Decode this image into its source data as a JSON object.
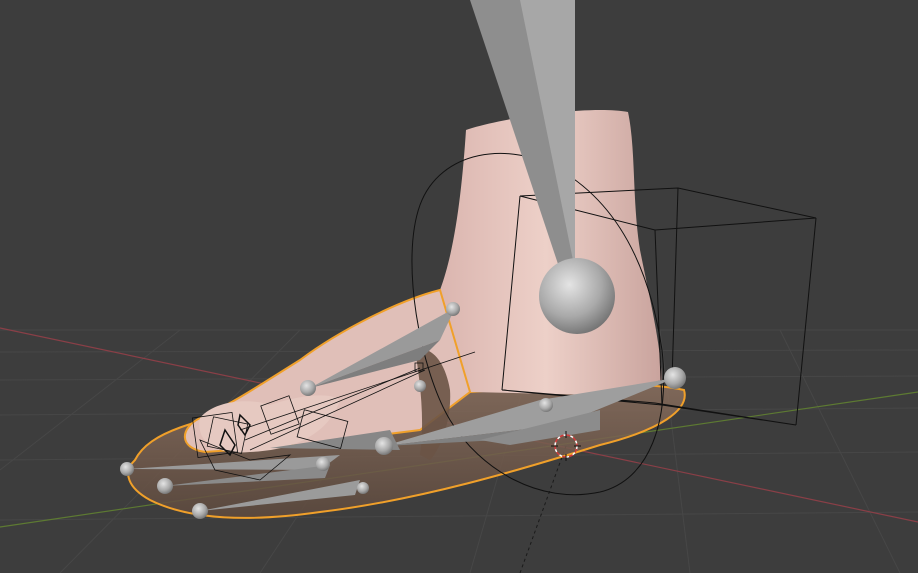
{
  "viewport": {
    "mode": "3D Viewport",
    "background_color": "#3d3d3d",
    "grid_color": "#474747",
    "x_axis_color": "#8a3f47",
    "y_axis_color": "#5d7a32",
    "selection_outline_color": "#f0a02a",
    "skin_color": "#e2c2bb",
    "bone_color": "#9a9a9a",
    "wire_color": "#111111"
  },
  "scene": {
    "objects": [
      {
        "name": "foot-mesh",
        "type": "mesh",
        "selected": true
      },
      {
        "name": "sandal-sole",
        "type": "mesh",
        "selected": true
      },
      {
        "name": "armature",
        "type": "armature",
        "bones_visible": true
      },
      {
        "name": "ik-control-circle",
        "type": "empty-circle"
      },
      {
        "name": "heel-control-cube",
        "type": "empty-cube"
      }
    ],
    "cursor_3d": true
  }
}
